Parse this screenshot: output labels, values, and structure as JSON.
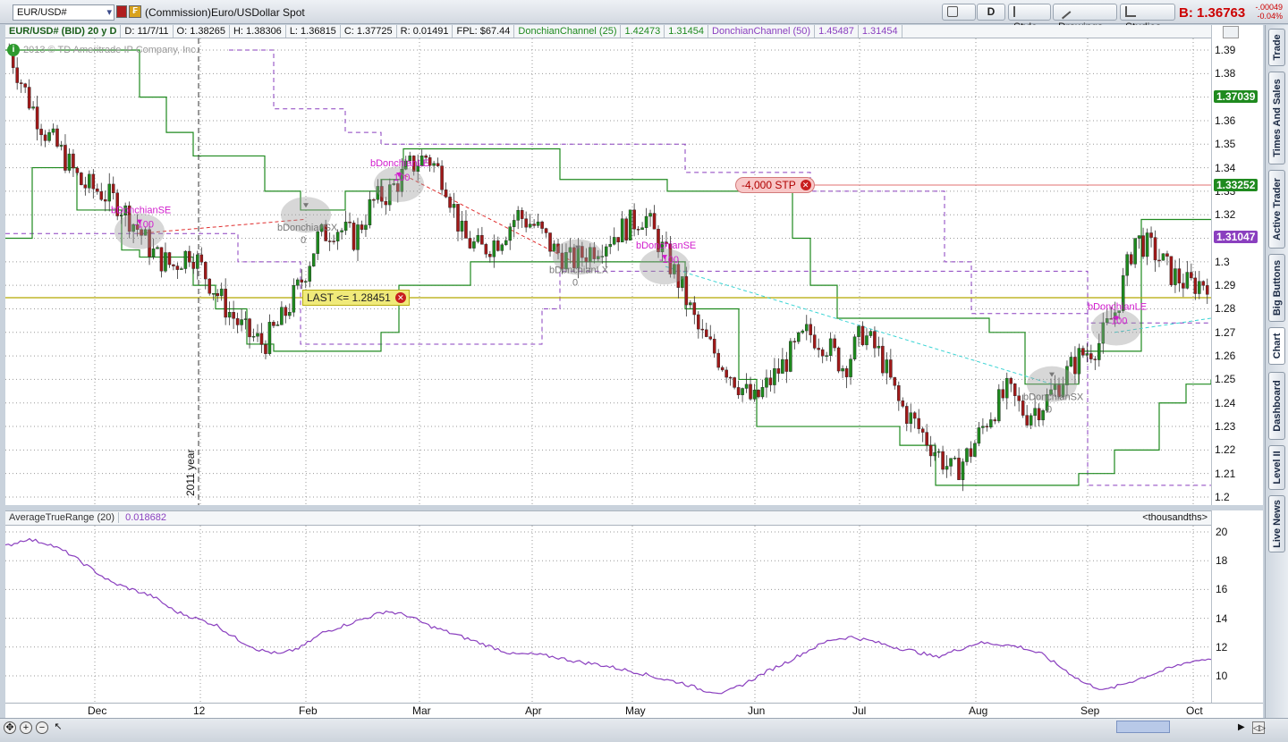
{
  "toolbar": {
    "symbol": "EUR/USD#",
    "description": "(Commission)Euro/USDollar Spot",
    "period_btn": "D",
    "style_label": "Style",
    "drawings_label": "Drawings",
    "studies_label": "Studies",
    "bid_label": "B: 1.36763",
    "change_abs": "-.00049",
    "change_pct": "-0.04%"
  },
  "infobar": {
    "items": [
      "EUR/USD# (BID) 20 y D",
      "D: 11/7/11",
      "O: 1.38265",
      "H: 1.38306",
      "L: 1.36815",
      "C: 1.37725",
      "R: 0.01491",
      "FPL: $67.44"
    ],
    "dc25_label": "DonchianChannel (25)",
    "dc25_upper": "1.42473",
    "dc25_lower": "1.31454",
    "dc50_label": "DonchianChannel (50)",
    "dc50_upper": "1.45487",
    "dc50_lower": "1.31454"
  },
  "copyright": "2013 © TD Ameritrade IP Company, Inc.",
  "year_marker": "2011 year",
  "price_axis": {
    "ticks": [
      "1.39",
      "1.38",
      "1.37",
      "1.36",
      "1.35",
      "1.34",
      "1.33",
      "1.32",
      "1.31",
      "1.3",
      "1.29",
      "1.28",
      "1.27",
      "1.26",
      "1.25",
      "1.24",
      "1.23",
      "1.22",
      "1.21",
      "1.2"
    ],
    "badges": [
      {
        "label": "1.37039",
        "color": "#1f8a1f",
        "value": 1.37039
      },
      {
        "label": "1.33252",
        "color": "#1f8a1f",
        "value": 1.33252
      },
      {
        "label": "1.31047",
        "color": "#8a3fbf",
        "value": 1.31047
      }
    ]
  },
  "orders": {
    "stop_label": "-4,000 STP",
    "alert_label": "LAST <= 1.28451"
  },
  "signals": [
    {
      "label": "bDonchianSE",
      "qty": "-100",
      "color": "#d11ccd"
    },
    {
      "label": "bDonchianSX",
      "qty": "0",
      "color": "#777777"
    },
    {
      "label": "bDonchianLE",
      "qty": "100",
      "color": "#d11ccd"
    },
    {
      "label": "bDonchianLX",
      "qty": "0",
      "color": "#777777"
    },
    {
      "label": "bDonchianSE",
      "qty": "-100",
      "color": "#d11ccd"
    },
    {
      "label": "bDonchianSX",
      "qty": "0",
      "color": "#777777"
    },
    {
      "label": "bDonchianLE",
      "qty": "100",
      "color": "#d11ccd"
    }
  ],
  "lower": {
    "study_label": "AverageTrueRange (20)",
    "study_value": "0.018682",
    "units": "<thousandths>",
    "ticks": [
      "20",
      "18",
      "16",
      "14",
      "12",
      "10"
    ]
  },
  "time_axis": [
    "Dec",
    "12",
    "Feb",
    "Mar",
    "Apr",
    "May",
    "Jun",
    "Jul",
    "Aug",
    "Sep",
    "Oct"
  ],
  "side_tabs": [
    "Trade",
    "Times And Sales",
    "Active Trader",
    "Big Buttons",
    "Chart",
    "Dashboard",
    "Level II",
    "Live News"
  ],
  "chart_data": {
    "type": "candlestick",
    "title": "EUR/USD# (BID) 20 y D",
    "y_range": [
      1.2,
      1.39
    ],
    "series": [
      {
        "name": "DonchianChannel (25)",
        "color": "#1f8a1f"
      },
      {
        "name": "DonchianChannel (50)",
        "color": "#8a3fbf"
      },
      {
        "name": "AverageTrueRange (20)",
        "color": "#8a3fbf",
        "last": 0.018682
      }
    ],
    "close_path": [
      1.39,
      1.37,
      1.355,
      1.345,
      1.333,
      1.33,
      1.325,
      1.315,
      1.303,
      1.298,
      1.305,
      1.292,
      1.28,
      1.27,
      1.265,
      1.275,
      1.29,
      1.31,
      1.315,
      1.31,
      1.325,
      1.33,
      1.34,
      1.345,
      1.335,
      1.31,
      1.305,
      1.31,
      1.32,
      1.315,
      1.305,
      1.3,
      1.305,
      1.31,
      1.315,
      1.32,
      1.305,
      1.29,
      1.27,
      1.26,
      1.25,
      1.24,
      1.25,
      1.26,
      1.27,
      1.265,
      1.255,
      1.27,
      1.26,
      1.24,
      1.23,
      1.22,
      1.21,
      1.22,
      1.235,
      1.245,
      1.235,
      1.24,
      1.25,
      1.26,
      1.265,
      1.28,
      1.31,
      1.305,
      1.295,
      1.29,
      1.292
    ],
    "atr_path": [
      19,
      19.5,
      19.2,
      18.5,
      17.5,
      16.5,
      16,
      15.5,
      14.5,
      14,
      13.5,
      12.5,
      11.8,
      11.5,
      12,
      13,
      13.5,
      14,
      14.5,
      14.2,
      13.5,
      13,
      12.5,
      12,
      11.5,
      11.5,
      11.3,
      11,
      10.8,
      10.5,
      10.2,
      9.8,
      9.5,
      9,
      8.8,
      9.5,
      10.3,
      11,
      11.8,
      12.5,
      12.7,
      12.4,
      12,
      11.7,
      11.3,
      11.8,
      12.3,
      12.2,
      12,
      11.5,
      10.5,
      9.5,
      9,
      9.5,
      10,
      10.5,
      11,
      11.2
    ]
  }
}
